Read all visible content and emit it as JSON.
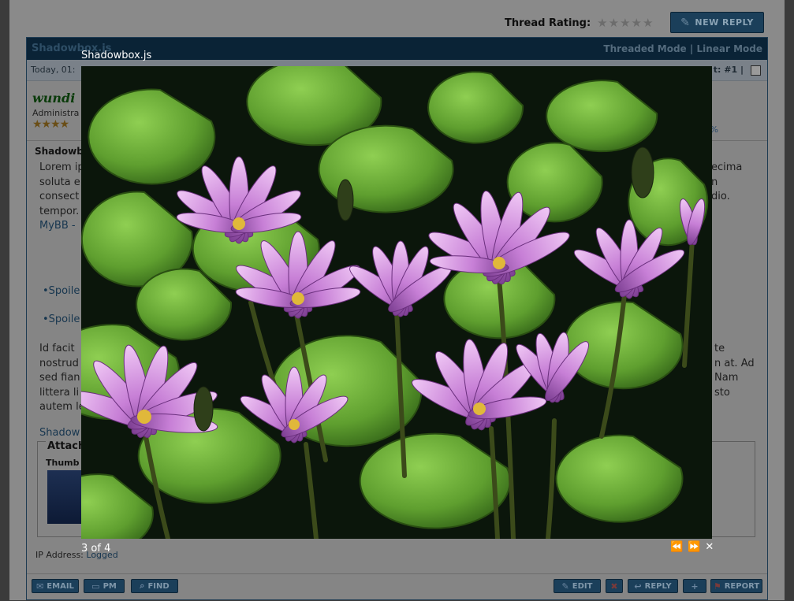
{
  "header": {
    "rating_label": "Thread Rating:",
    "new_reply_label": "NEW REPLY"
  },
  "thread": {
    "title": "Shadowbox.js",
    "modes": "Threaded Mode | Linear Mode",
    "date": "Today, 01:",
    "post_number": "t: #1 |"
  },
  "author": {
    "name": "wundi",
    "role": "Administra",
    "percent": "%"
  },
  "post": {
    "subject": "Shadowb",
    "left_lines": [
      "Lorem ip",
      "soluta e",
      "consect",
      "tempor.",
      "MyBB -"
    ],
    "right_lines": [
      "ecima",
      "",
      "n",
      "dio."
    ],
    "spoilers": [
      "Spoile",
      "Spoile"
    ],
    "left_lines2": [
      "Id facit",
      "nostrud",
      "sed fian",
      "littera li",
      "autem le"
    ],
    "right_lines2": [
      "te",
      "n at. Ad",
      "Nam",
      "sto"
    ],
    "link": "Shadow"
  },
  "attachments": {
    "title": "Attach",
    "thumbs_label": "Thumb"
  },
  "ip_address": {
    "label": "IP Address:",
    "value": "Logged"
  },
  "post_buttons": {
    "email": "EMAIL",
    "pm": "PM",
    "find": "FIND",
    "edit": "EDIT",
    "reply": "REPLY",
    "report": "REPORT"
  },
  "shadowbox": {
    "title": "Shadowbox.js",
    "counter": "3 of 4",
    "controls": {
      "previous": "⏪",
      "next": "⏩",
      "close": "✕"
    }
  },
  "colors": {
    "overlay": "#3b3b3b",
    "lily_pink": "#c77fd6",
    "pad_green": "#5f9f2f",
    "button_blue": "#1b3f5a"
  }
}
